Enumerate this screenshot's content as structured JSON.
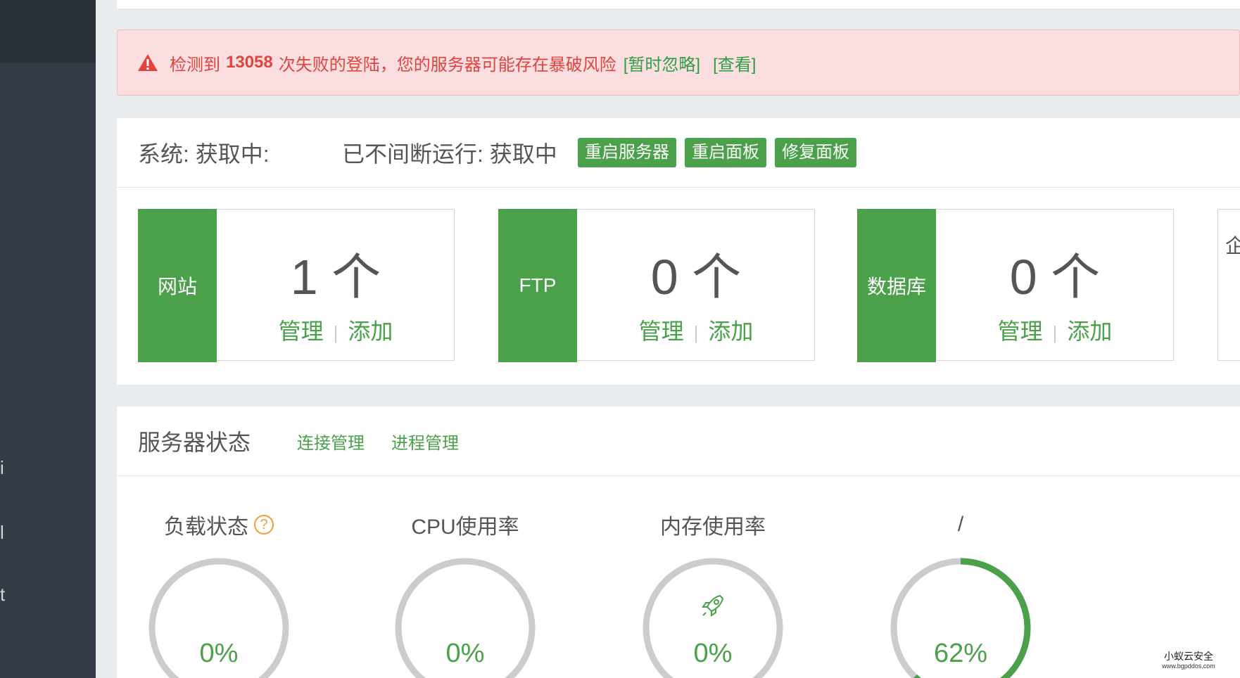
{
  "sidebar": {
    "fragments": [
      "i",
      "l",
      "t"
    ]
  },
  "alert": {
    "prefix": "检测到",
    "count": "13058",
    "message": "次失败的登陆，您的服务器可能存在暴破风险",
    "ignore_link": "[暂时忽略]",
    "view_link": "[查看]",
    "color": "#e2433c"
  },
  "system_bar": {
    "system_text": "系统: 获取中:",
    "uptime_text": "已不间断运行: 获取中",
    "restart_server": "重启服务器",
    "restart_panel": "重启面板",
    "repair_panel": "修复面板"
  },
  "stats": {
    "cards": [
      {
        "label": "网站",
        "count": "1 个",
        "manage": "管理",
        "sep": "|",
        "add": "添加"
      },
      {
        "label": "FTP",
        "count": "0 个",
        "manage": "管理",
        "sep": "|",
        "add": "添加"
      },
      {
        "label": "数据库",
        "count": "0 个",
        "manage": "管理",
        "sep": "|",
        "add": "添加"
      }
    ],
    "partial_card_char": "企"
  },
  "server_status": {
    "title": "服务器状态",
    "connection_mgmt": "连接管理",
    "process_mgmt": "进程管理",
    "gauges": [
      {
        "label": "负载状态",
        "value": "0%",
        "percent": 0,
        "icon": "question-icon"
      },
      {
        "label": "CPU使用率",
        "value": "0%",
        "percent": 0
      },
      {
        "label": "内存使用率",
        "value": "0%",
        "percent": 0,
        "icon": "rocket-icon"
      },
      {
        "label": "/",
        "value": "62%",
        "percent": 62
      }
    ]
  },
  "watermark": {
    "name": "小蚁云安全",
    "url": "www.bgpddos.com"
  },
  "colors": {
    "accent_green": "#4aa14a",
    "sidebar": "#353c46",
    "alert_bg": "#fbdfe0",
    "gauge_track": "#cccccc"
  }
}
